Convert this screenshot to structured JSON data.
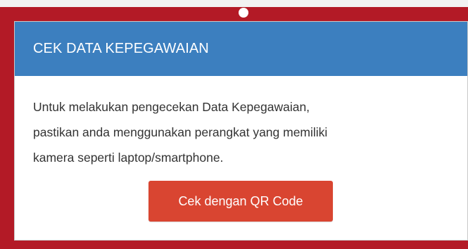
{
  "colors": {
    "frame": "#b31a26",
    "header": "#3c7fbf",
    "button": "#d94531",
    "background": "#f2f2f2"
  },
  "card": {
    "title": "CEK DATA KEPEGAWAIAN",
    "body_lines": [
      "Untuk melakukan pengecekan Data Kepegawaian,",
      "pastikan anda menggunakan perangkat yang memiliki",
      "kamera seperti laptop/smartphone."
    ],
    "button_label": "Cek dengan QR Code"
  }
}
